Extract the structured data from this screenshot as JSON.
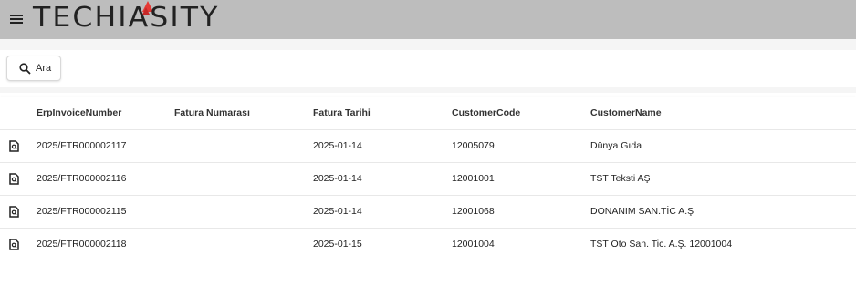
{
  "header": {
    "brand": "TECHIASITY",
    "menu_icon": "hamburger-menu-icon",
    "accent_color": "#e53935"
  },
  "toolbar": {
    "search_label": "Ara",
    "search_icon": "search-icon"
  },
  "table": {
    "columns": [
      "ErpInvoiceNumber",
      "Fatura Numarası",
      "Fatura Tarihi",
      "CustomerCode",
      "CustomerName"
    ],
    "row_icon": "document-search-icon",
    "rows": [
      {
        "erp": "2025/FTR000002117",
        "fatura_no": "",
        "tarih": "2025-01-14",
        "code": "12005079",
        "name": "Dünya Gıda"
      },
      {
        "erp": "2025/FTR000002116",
        "fatura_no": "",
        "tarih": "2025-01-14",
        "code": "12001001",
        "name": "TST Teksti AŞ"
      },
      {
        "erp": "2025/FTR000002115",
        "fatura_no": "",
        "tarih": "2025-01-14",
        "code": "12001068",
        "name": "DONANIM SAN.TİC A.Ş"
      },
      {
        "erp": "2025/FTR000002118",
        "fatura_no": "",
        "tarih": "2025-01-15",
        "code": "12001004",
        "name": "TST Oto San. Tic. A.Ş. 12001004"
      }
    ]
  }
}
